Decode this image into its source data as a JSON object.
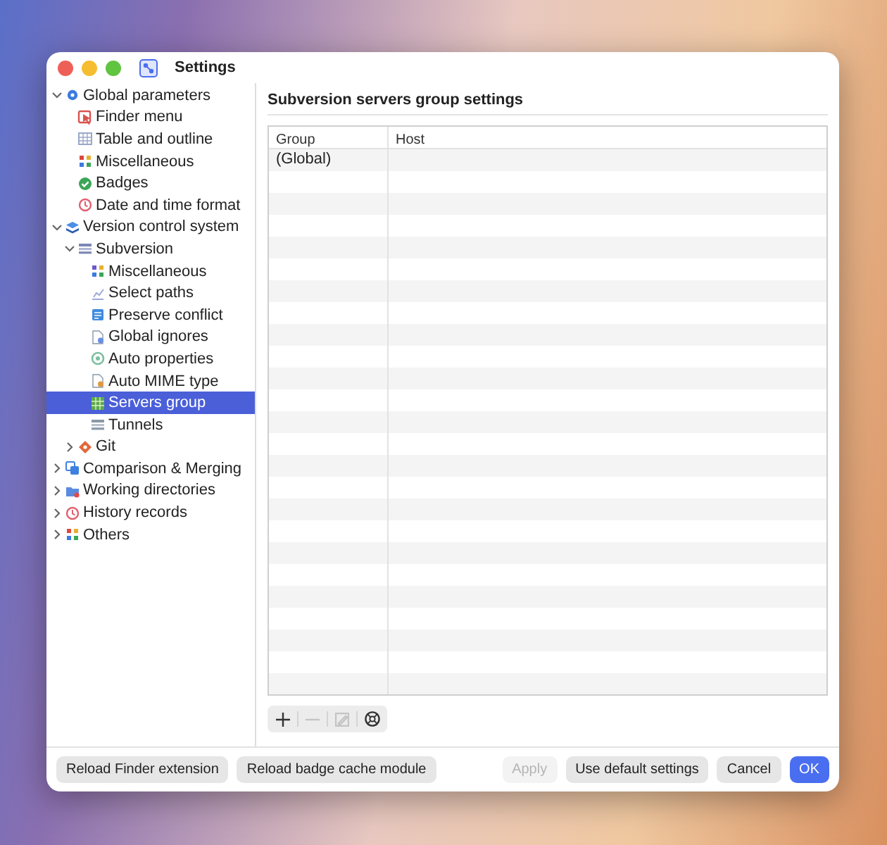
{
  "window": {
    "title": "Settings"
  },
  "sidebar": {
    "items": [
      {
        "label": "Global parameters",
        "expanded": true,
        "selected": false,
        "children": [
          {
            "label": "Finder menu",
            "selected": false
          },
          {
            "label": "Table and outline",
            "selected": false
          },
          {
            "label": "Miscellaneous",
            "selected": false
          },
          {
            "label": "Badges",
            "selected": false
          },
          {
            "label": "Date and time format",
            "selected": false
          }
        ]
      },
      {
        "label": "Version control system",
        "expanded": true,
        "selected": false,
        "children": [
          {
            "label": "Subversion",
            "expanded": true,
            "selected": false,
            "children": [
              {
                "label": "Miscellaneous",
                "selected": false
              },
              {
                "label": "Select paths",
                "selected": false
              },
              {
                "label": "Preserve conflict",
                "selected": false
              },
              {
                "label": "Global ignores",
                "selected": false
              },
              {
                "label": "Auto properties",
                "selected": false
              },
              {
                "label": "Auto MIME type",
                "selected": false
              },
              {
                "label": "Servers group",
                "selected": true
              },
              {
                "label": "Tunnels",
                "selected": false
              }
            ]
          },
          {
            "label": "Git",
            "expanded": false,
            "selected": false
          }
        ]
      },
      {
        "label": "Comparison & Merging",
        "expanded": false,
        "selected": false
      },
      {
        "label": "Working directories",
        "expanded": false,
        "selected": false
      },
      {
        "label": "History records",
        "expanded": false,
        "selected": false
      },
      {
        "label": "Others",
        "expanded": false,
        "selected": false
      }
    ]
  },
  "panel": {
    "title": "Subversion servers group settings",
    "table": {
      "columns": [
        "Group",
        "Host"
      ],
      "rows": [
        [
          "(Global)"
        ]
      ]
    },
    "toolbar": [
      {
        "kind": "add",
        "disabled": false
      },
      {
        "kind": "remove",
        "disabled": true
      },
      {
        "kind": "edit",
        "disabled": true
      },
      {
        "kind": "action",
        "disabled": false
      }
    ]
  },
  "footer": {
    "buttons": [
      {
        "label": "Reload Finder extension",
        "kind": "utility",
        "disabled": false
      },
      {
        "label": "Reload badge cache module",
        "kind": "utility",
        "disabled": false
      },
      {
        "label": "Apply",
        "kind": "default",
        "disabled": true
      },
      {
        "label": "Use default settings",
        "kind": "default",
        "disabled": false
      },
      {
        "label": "Cancel",
        "kind": "default",
        "disabled": false
      },
      {
        "label": "OK",
        "kind": "primary",
        "disabled": false
      }
    ]
  }
}
